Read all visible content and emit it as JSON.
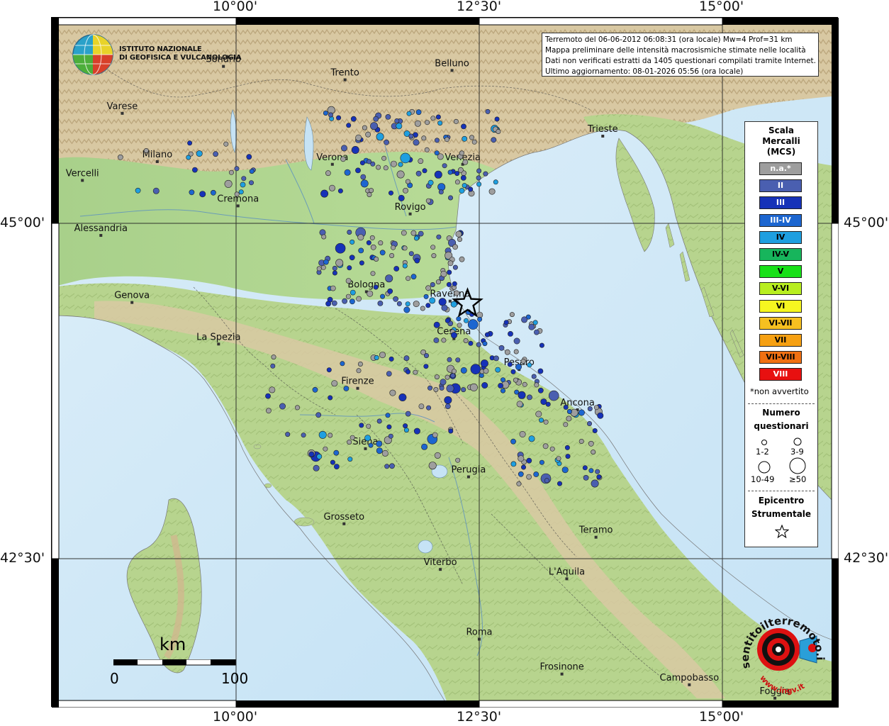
{
  "title": {
    "line1": "Terremoto del 06-06-2012 06:08:31 (ora locale) Mw=4 Prof=31 km",
    "line2": "Mappa preliminare delle intensità macrosismiche stimate nelle località",
    "line3": "Dati non verificati estratti da 1405 questionari compilati tramite Internet.",
    "line4": "Ultimo aggiornamento: 08-01-2026 05:56 (ora locale)"
  },
  "logo": {
    "name_line1": "ISTITUTO NAZIONALE",
    "name_line2": "DI GEOFISICA E VULCANOLOGIA"
  },
  "axes": {
    "top": [
      "10°00'",
      "12°30'",
      "15°00'"
    ],
    "bottom": [
      "10°00'",
      "12°30'",
      "15°00'"
    ],
    "left": [
      "45°00'",
      "42°30'"
    ],
    "right": [
      "45°00'",
      "42°30'"
    ]
  },
  "places": [
    {
      "name": "Sondrio",
      "lon": 9.87,
      "lat": 46.17
    },
    {
      "name": "Belluno",
      "lon": 12.22,
      "lat": 46.14
    },
    {
      "name": "Trento",
      "lon": 11.12,
      "lat": 46.07
    },
    {
      "name": "Varese",
      "lon": 8.83,
      "lat": 45.82
    },
    {
      "name": "Trieste",
      "lon": 13.77,
      "lat": 45.65
    },
    {
      "name": "Milano",
      "lon": 9.19,
      "lat": 45.46
    },
    {
      "name": "Verona",
      "lon": 10.99,
      "lat": 45.44
    },
    {
      "name": "Venezia",
      "lon": 12.33,
      "lat": 45.44
    },
    {
      "name": "Vercelli",
      "lon": 8.42,
      "lat": 45.32
    },
    {
      "name": "Cremona",
      "lon": 10.02,
      "lat": 45.13
    },
    {
      "name": "Rovigo",
      "lon": 11.79,
      "lat": 45.07
    },
    {
      "name": "Alessandria",
      "lon": 8.61,
      "lat": 44.91
    },
    {
      "name": "Bologna",
      "lon": 11.34,
      "lat": 44.49
    },
    {
      "name": "Ravenna",
      "lon": 12.2,
      "lat": 44.42
    },
    {
      "name": "Genova",
      "lon": 8.93,
      "lat": 44.41
    },
    {
      "name": "Cesena",
      "lon": 12.24,
      "lat": 44.14
    },
    {
      "name": "La Spezia",
      "lon": 9.82,
      "lat": 44.1
    },
    {
      "name": "Pesaro",
      "lon": 12.91,
      "lat": 43.91
    },
    {
      "name": "Firenze",
      "lon": 11.25,
      "lat": 43.77
    },
    {
      "name": "Ancona",
      "lon": 13.51,
      "lat": 43.61
    },
    {
      "name": "Siena",
      "lon": 11.33,
      "lat": 43.32
    },
    {
      "name": "Perugia",
      "lon": 12.39,
      "lat": 43.11
    },
    {
      "name": "Grosseto",
      "lon": 11.11,
      "lat": 42.76
    },
    {
      "name": "Teramo",
      "lon": 13.7,
      "lat": 42.66
    },
    {
      "name": "Viterbo",
      "lon": 12.1,
      "lat": 42.42
    },
    {
      "name": "L'Aquila",
      "lon": 13.4,
      "lat": 42.35
    },
    {
      "name": "Roma",
      "lon": 12.5,
      "lat": 41.9
    },
    {
      "name": "Frosinone",
      "lon": 13.35,
      "lat": 41.64
    },
    {
      "name": "Campobasso",
      "lon": 14.66,
      "lat": 41.56
    },
    {
      "name": "Foggia",
      "lon": 15.54,
      "lat": 41.46
    }
  ],
  "epicenter": {
    "lon": 12.38,
    "lat": 44.4
  },
  "legend": {
    "title_lines": [
      "Scala",
      "Mercalli",
      "(MCS)"
    ],
    "classes": [
      {
        "label": "n.a.*",
        "color": "#9e9e9e",
        "text_color": "#ffffff"
      },
      {
        "label": "II",
        "color": "#4a5fb0",
        "text_color": "#ffffff"
      },
      {
        "label": "III",
        "color": "#1632b8",
        "text_color": "#ffffff"
      },
      {
        "label": "III-IV",
        "color": "#1c66d0",
        "text_color": "#ffffff"
      },
      {
        "label": "IV",
        "color": "#1e9fe0",
        "text_color": "#000000"
      },
      {
        "label": "IV-V",
        "color": "#17b55c",
        "text_color": "#000000"
      },
      {
        "label": "V",
        "color": "#18e018",
        "text_color": "#000000"
      },
      {
        "label": "V-VI",
        "color": "#b8ee20",
        "text_color": "#000000"
      },
      {
        "label": "VI",
        "color": "#f6f620",
        "text_color": "#000000"
      },
      {
        "label": "VI-VII",
        "color": "#f6c020",
        "text_color": "#000000"
      },
      {
        "label": "VII",
        "color": "#f6a012",
        "text_color": "#000000"
      },
      {
        "label": "VII-VIII",
        "color": "#f07012",
        "text_color": "#000000"
      },
      {
        "label": "VIII",
        "color": "#e81010",
        "text_color": "#ffffff"
      }
    ],
    "note": "*non avvertito",
    "count_title_lines": [
      "Numero",
      "questionari"
    ],
    "count_classes": [
      "1-2",
      "3-9",
      "10-49",
      "≥50"
    ],
    "epicenter_title_lines": [
      "Epicentro",
      "Strumentale"
    ]
  },
  "scale_bar": {
    "unit": "km",
    "min": "0",
    "max": "100"
  },
  "badge": {
    "text": "sentitoilterremoto.it",
    "reverse_text": "www.ingv.it"
  }
}
